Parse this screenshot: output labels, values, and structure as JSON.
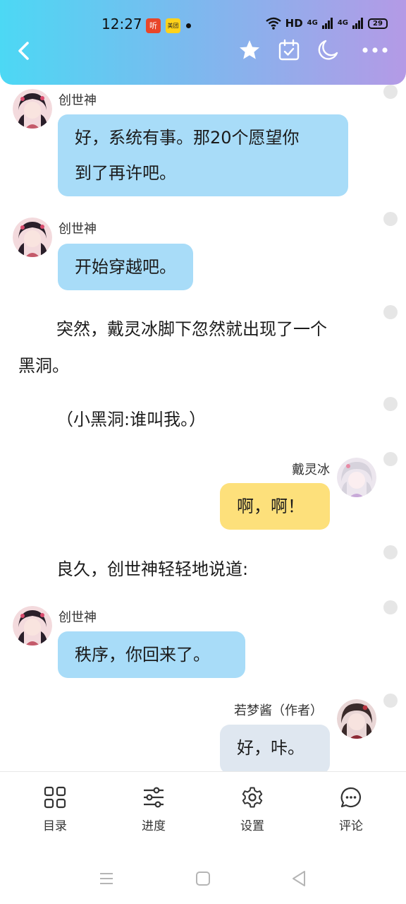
{
  "status_bar": {
    "time": "12:27",
    "app1": "听",
    "app2": "美团",
    "hd": "HD",
    "net1": "4G",
    "net2": "4G",
    "battery": "29"
  },
  "header": {
    "accent_start": "#4cd8f4",
    "accent_end": "#b49ae6",
    "icons": [
      "back-icon",
      "star-icon",
      "calendar-check-icon",
      "moon-icon",
      "more-icon"
    ]
  },
  "messages": {
    "m1": {
      "speaker": "创世神",
      "text_line1": "好，系统有事。那20个愿望你",
      "text_line2": "到了再许吧。"
    },
    "m2": {
      "speaker": "创世神",
      "text": "开始穿越吧。"
    },
    "n1": {
      "line1": "突然，戴灵冰脚下忽然就出现了一个",
      "line2": "黑洞。"
    },
    "n2": {
      "text": "（小黑洞:谁叫我。）"
    },
    "m3": {
      "speaker": "戴灵冰",
      "text": "啊，啊！"
    },
    "n3": {
      "text": "良久，创世神轻轻地说道:"
    },
    "m4": {
      "speaker": "创世神",
      "text": "秩序，你回来了。"
    },
    "m5": {
      "speaker": "若梦酱（作者）",
      "text": "好，咔。"
    }
  },
  "bubble_colors": {
    "left": "#a8dcf8",
    "right_character": "#fde07b",
    "right_author": "#dfe7f0"
  },
  "bottom_nav": {
    "catalog": "目录",
    "progress": "进度",
    "settings": "设置",
    "comments": "评论"
  },
  "system_nav": [
    "menu-icon",
    "home-icon",
    "back-triangle-icon"
  ]
}
